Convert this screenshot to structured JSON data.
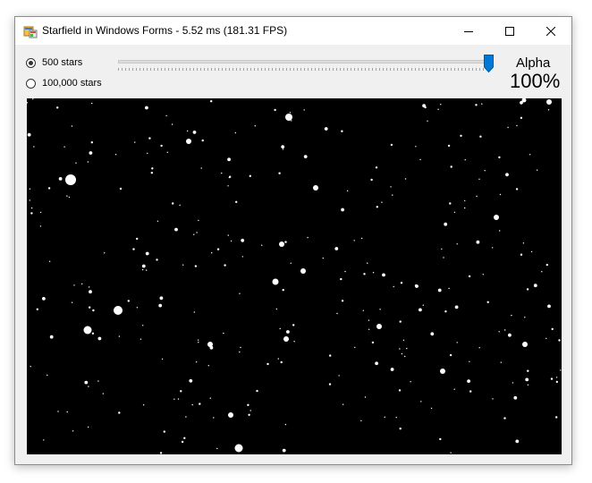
{
  "window": {
    "title": "Starfield in Windows Forms - 5.52 ms (181.31 FPS)",
    "icon": "windows-forms-app-icon",
    "controls": [
      "minimize-icon",
      "maximize-icon",
      "close-icon"
    ]
  },
  "options": {
    "radio_500": {
      "label": "500 stars",
      "checked": true
    },
    "radio_100k": {
      "label": "100,000 stars",
      "checked": false
    }
  },
  "alpha": {
    "label": "Alpha",
    "value_text": "100%",
    "slider_fraction": 1.0
  },
  "starfield": {
    "background": "#000000",
    "star_color": "#ffffff"
  }
}
